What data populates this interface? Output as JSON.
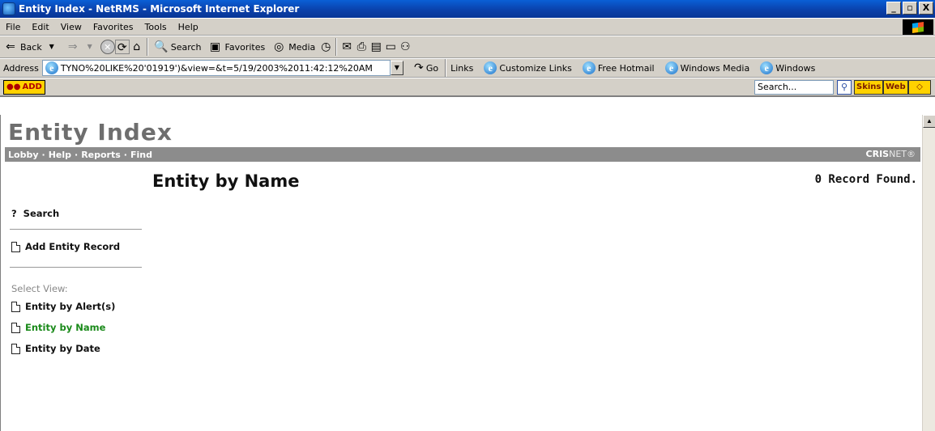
{
  "window": {
    "title": "Entity Index - NetRMS - Microsoft Internet Explorer",
    "buttons": [
      "_",
      "ё",
      "X"
    ]
  },
  "menu": [
    "File",
    "Edit",
    "View",
    "Favorites",
    "Tools",
    "Help"
  ],
  "toolbar": {
    "back": "Back",
    "search": "Search",
    "favorites": "Favorites",
    "media": "Media"
  },
  "address_bar": {
    "label": "Address",
    "value": "TYNO%20LIKE%20'01919')&view=&t=5/19/2003%2011:42:12%20AM",
    "go": "Go",
    "links_label": "Links",
    "links": [
      "Customize Links",
      "Free Hotmail",
      "Windows Media",
      "Windows"
    ]
  },
  "addon_bar": {
    "add_label": "ADD",
    "search_placeholder": "Search...",
    "skins_label": "Skins",
    "web_label": "Web"
  },
  "page": {
    "title": "Entity Index",
    "nav": [
      "Lobby",
      "Help",
      "Reports",
      "Find"
    ],
    "nav_separator": "·",
    "brand_bold": "CRIS",
    "brand_light": "NET®",
    "section_title": "Entity by Name",
    "record_count": "0 Record Found."
  },
  "sidebar": {
    "search_mark": "?",
    "search_label": "Search",
    "add_record_label": "Add Entity Record",
    "select_view_label": "Select View:",
    "views": [
      {
        "label": "Entity by Alert(s)",
        "active": false
      },
      {
        "label": "Entity by Name",
        "active": true
      },
      {
        "label": "Entity by Date",
        "active": false
      }
    ]
  },
  "colors": {
    "title_bar": "#0a4fc4",
    "chrome": "#d4d0c8",
    "nav_bar": "#8c8c8c",
    "active_view": "#1a8a1a",
    "page_title": "#6e6e6e"
  }
}
